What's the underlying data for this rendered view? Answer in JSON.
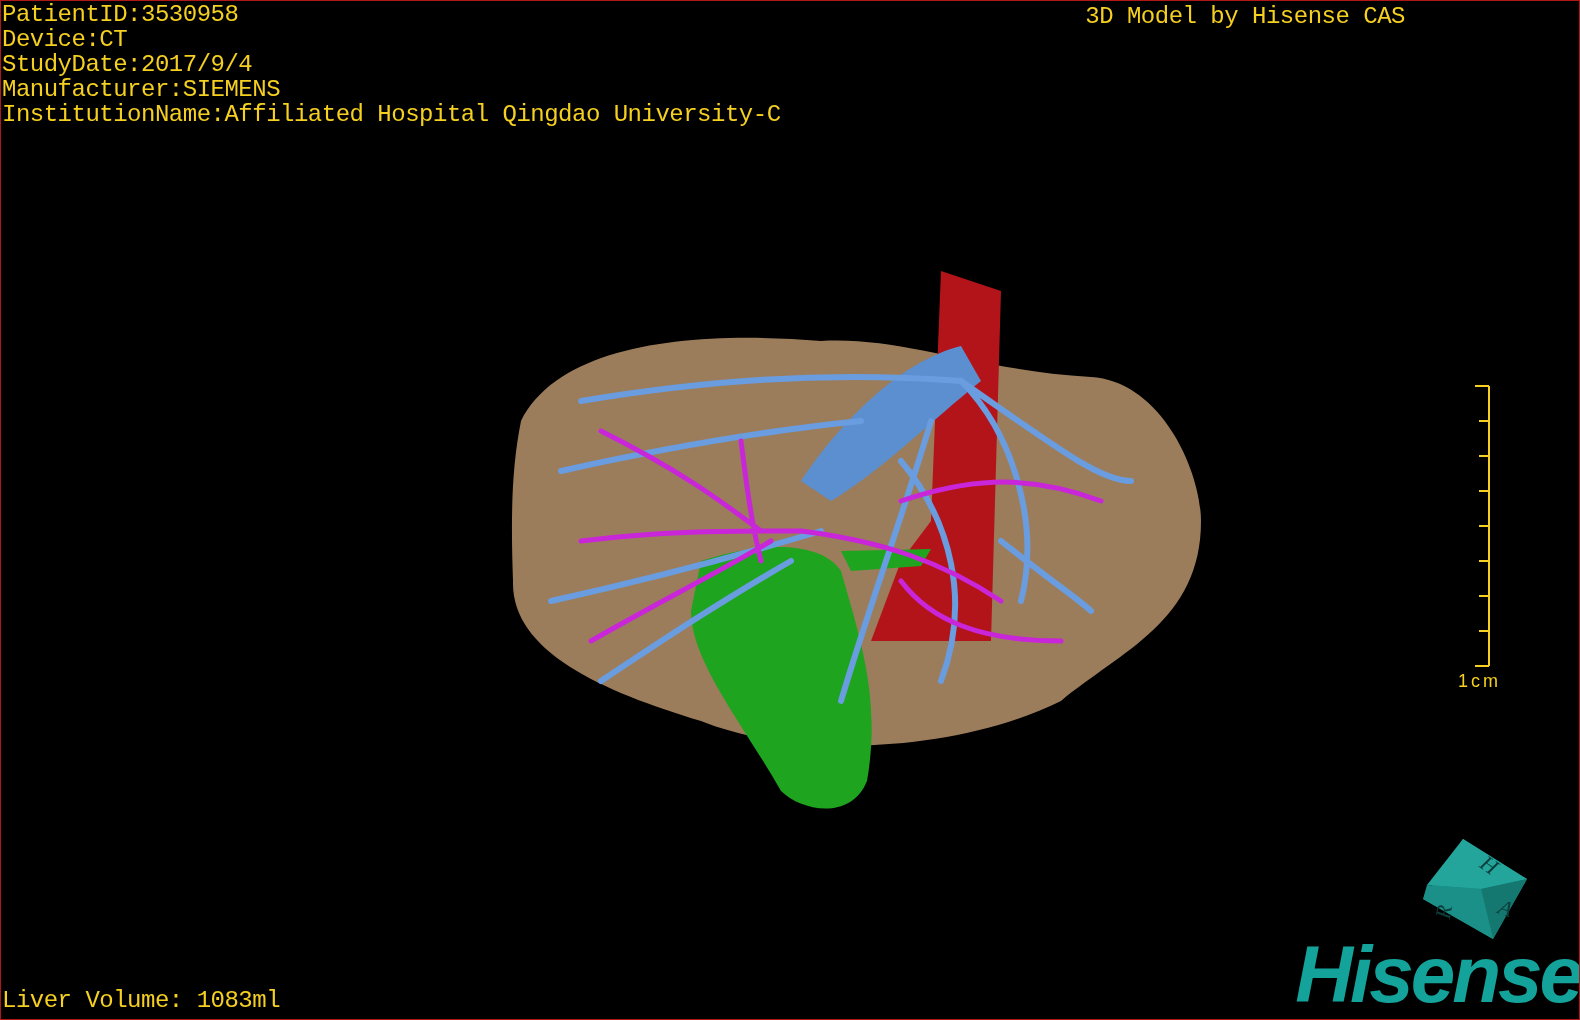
{
  "info_lines": [
    "PatientID:3530958",
    "Device:CT",
    "StudyDate:2017/9/4",
    "Manufacturer:SIEMENS",
    "InstitutionName:Affiliated Hospital Qingdao University-C"
  ],
  "title": "3D Model by Hisense CAS",
  "scale_bar": {
    "label": "1cm"
  },
  "liver_volume": "Liver Volume: 1083ml",
  "orientation_cube": {
    "faces": [
      "H",
      "R",
      "A"
    ]
  },
  "logo": {
    "text": "Hisense"
  }
}
